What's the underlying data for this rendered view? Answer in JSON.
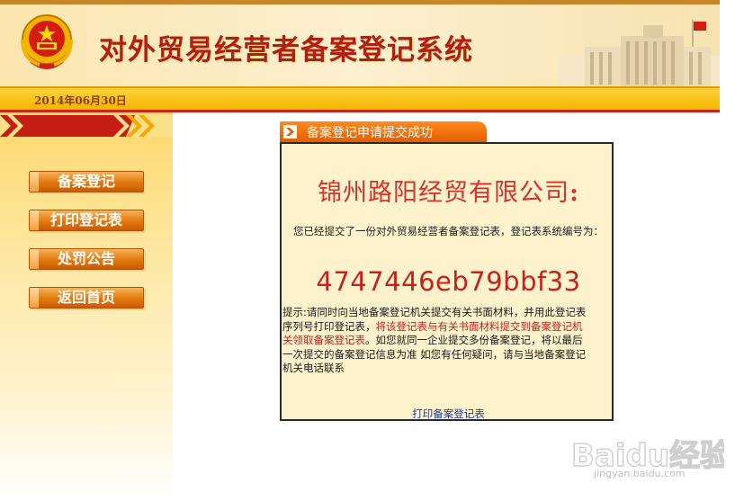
{
  "header": {
    "title": "对外贸易经营者备案登记系统",
    "date": "2014年06月30日"
  },
  "sidebar": {
    "items": [
      {
        "label": "备案登记"
      },
      {
        "label": "打印登记表"
      },
      {
        "label": "处罚公告"
      },
      {
        "label": "返回首页"
      }
    ]
  },
  "panel": {
    "tab_title": "备案登记申请提交成功",
    "company_name": "锦州路阳经贸有限公司",
    "company_colon": ":",
    "notice": "您已经提交了一份对外贸易经营者备案登记表，登记表系统编号为：",
    "registration_number": "4747446eb79bbf33",
    "tips_prefix": "提示:请同时向当地备案登记机关提交有关书面材料，并用此登记表序列号打印登记表，",
    "tips_red": "将该登记表与有关书面材料提交到备案登记机关领取备案登记表",
    "tips_suffix": "。如您就同一企业提交多份备案登记，将以最后一次提交的备案登记信息为准 如您有任何疑问，请与当地备案登记机关电话联系",
    "print_link": "打印备案登记表"
  },
  "watermark": {
    "brand": "Baidu经验",
    "url": "jingyan.baidu.com"
  },
  "colors": {
    "accent_red": "#c8211c",
    "tab_orange": "#e35d00",
    "panel_bg": "#fdf2cc",
    "date_bar": "#f4b400"
  }
}
